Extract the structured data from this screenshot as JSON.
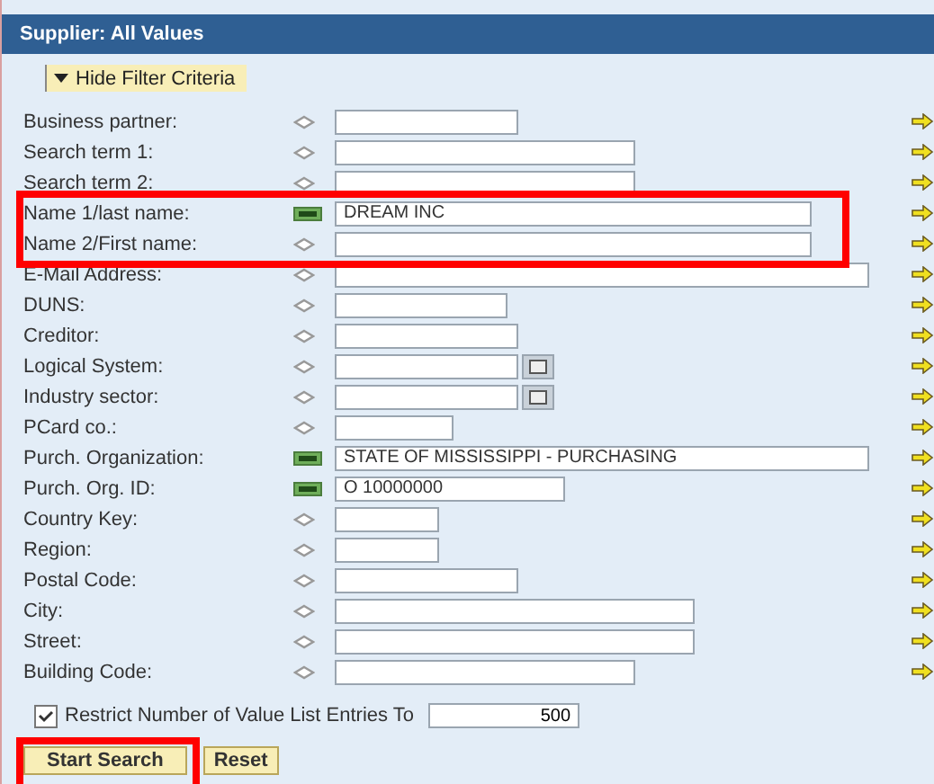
{
  "title": "Supplier: All Values",
  "filter_toggle": {
    "label": "Hide Filter Criteria",
    "expanded": true
  },
  "fields": [
    {
      "label": "Business partner:",
      "kind": "any",
      "value_help": false
    },
    {
      "label": "Search term 1:",
      "kind": "any",
      "value_help": false
    },
    {
      "label": "Search term 2:",
      "kind": "any",
      "value_help": false
    },
    {
      "label": "Name 1/last name:",
      "kind": "equals",
      "value": "DREAM INC",
      "value_help": false
    },
    {
      "label": "Name 2/First name:",
      "kind": "any",
      "value_help": false
    },
    {
      "label": "E-Mail Address:",
      "kind": "any",
      "value_help": false
    },
    {
      "label": "DUNS:",
      "kind": "any",
      "value_help": false
    },
    {
      "label": "Creditor:",
      "kind": "any",
      "value_help": false
    },
    {
      "label": "Logical System:",
      "kind": "any",
      "value_help": true
    },
    {
      "label": "Industry sector:",
      "kind": "any",
      "value_help": true
    },
    {
      "label": "PCard co.:",
      "kind": "any",
      "value_help": false
    },
    {
      "label": "Purch. Organization:",
      "kind": "equals",
      "value": "STATE OF MISSISSIPPI - PURCHASING",
      "value_help": false
    },
    {
      "label": "Purch. Org. ID:",
      "kind": "equals",
      "value": "O 10000000",
      "value_help": false
    },
    {
      "label": "Country Key:",
      "kind": "any",
      "value_help": false
    },
    {
      "label": "Region:",
      "kind": "any",
      "value_help": false
    },
    {
      "label": "Postal Code:",
      "kind": "any",
      "value_help": false
    },
    {
      "label": "City:",
      "kind": "any",
      "value_help": false
    },
    {
      "label": "Street:",
      "kind": "any",
      "value_help": false
    },
    {
      "label": "Building Code:",
      "kind": "any",
      "value_help": false
    }
  ],
  "restrict": {
    "label": "Restrict Number of Value List Entries To",
    "checked": true,
    "value": "500"
  },
  "buttons": [
    "Start Search",
    "Reset"
  ]
}
